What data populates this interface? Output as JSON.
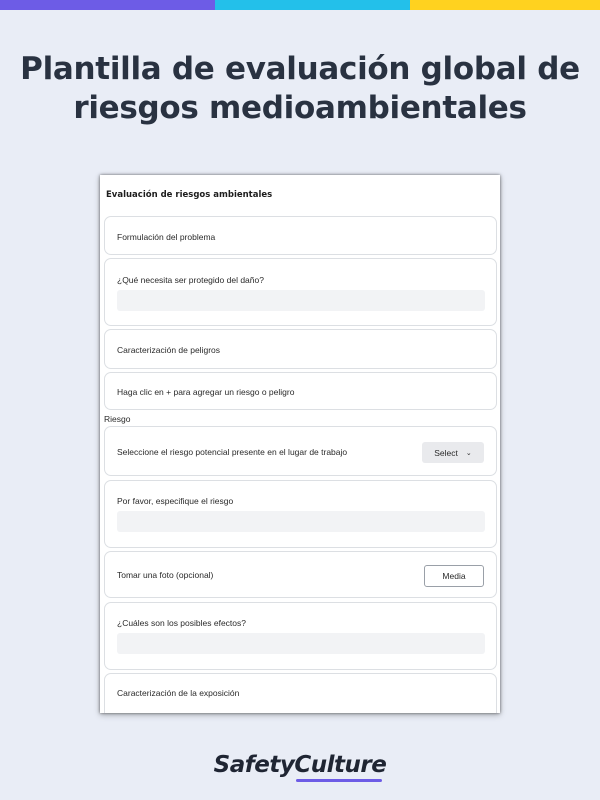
{
  "brand_colors": [
    "#6d5ce6",
    "#23c0ea",
    "#ffd21f"
  ],
  "headline": {
    "line1": "Plantilla de evaluación global de",
    "line2": "riesgos medioambientales"
  },
  "form": {
    "title": "Evaluación de riesgos ambientales",
    "problem_formulation": "Formulación del problema",
    "protect_question": "¿Qué necesita ser protegido del daño?",
    "protect_value": "",
    "hazard_characterization": "Caracterización de peligros",
    "add_hazard_hint": "Haga clic en + para agregar un riesgo o peligro",
    "riesgo_section": "Riesgo",
    "select_risk_label": "Seleccione el riesgo potencial presente en el lugar de trabajo",
    "select_value": "Select",
    "specify_risk_label": "Por favor, especifique el riesgo",
    "specify_risk_value": "",
    "photo_label": "Tomar una foto (opcional)",
    "media_button": "Media",
    "effects_question": "¿Cuáles son los posibles efectos?",
    "effects_value": "",
    "exposure_characterization": "Caracterización de la exposición"
  },
  "logo": {
    "text": "SafetyCulture"
  }
}
